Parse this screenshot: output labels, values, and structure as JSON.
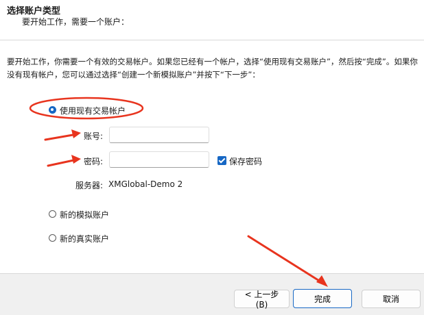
{
  "header": {
    "title": "选择账户类型",
    "subtitle": "要开始工作，需要一个账户："
  },
  "intro": {
    "text": "要开始工作，你需要一个有效的交易帐户。如果您已经有一个帐户，选择“使用现有交易账户”，然后按“完成”。如果你没有现有帐户，您可以通过选择“创建一个新模拟账户”并按下“下一步”："
  },
  "options": {
    "existing": {
      "label": "使用现有交易帐户",
      "checked": true
    },
    "demo": {
      "label": "新的模拟账户",
      "checked": false
    },
    "real": {
      "label": "新的真实账户",
      "checked": false
    }
  },
  "form": {
    "account_label": "账号:",
    "account_value": "",
    "password_label": "密码:",
    "password_value": "",
    "save_password": {
      "label": "保存密码",
      "checked": true
    },
    "server_label": "服务器:",
    "server_value": "XMGlobal-Demo 2"
  },
  "footer": {
    "back_label": "< 上一步(B)",
    "finish_label": "完成",
    "cancel_label": "取消"
  },
  "colors": {
    "accent": "#1667c4",
    "annotation": "#e8341e",
    "footer_bg": "#f0f0f0"
  }
}
